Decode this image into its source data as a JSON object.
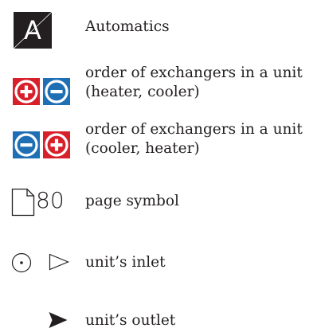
{
  "automatics": {
    "badge_letter": "A",
    "label": "Automatics"
  },
  "heater_cooler": {
    "icons": [
      "plus-circle-icon",
      "minus-circle-icon"
    ],
    "label_line1": "order of exchangers in a unit",
    "label_line2": "(heater, cooler)"
  },
  "cooler_heater": {
    "icons": [
      "minus-circle-icon",
      "plus-circle-icon"
    ],
    "label_line1": "order of exchangers in a unit",
    "label_line2": "(cooler, heater)"
  },
  "page_symbol": {
    "number": "80",
    "label": "page symbol"
  },
  "inlet": {
    "label": "unit’s inlet"
  },
  "outlet": {
    "label": "unit’s outlet"
  },
  "colors": {
    "heater_red": "#d7202a",
    "cooler_blue": "#1f6fb5",
    "ink": "#231f20"
  }
}
